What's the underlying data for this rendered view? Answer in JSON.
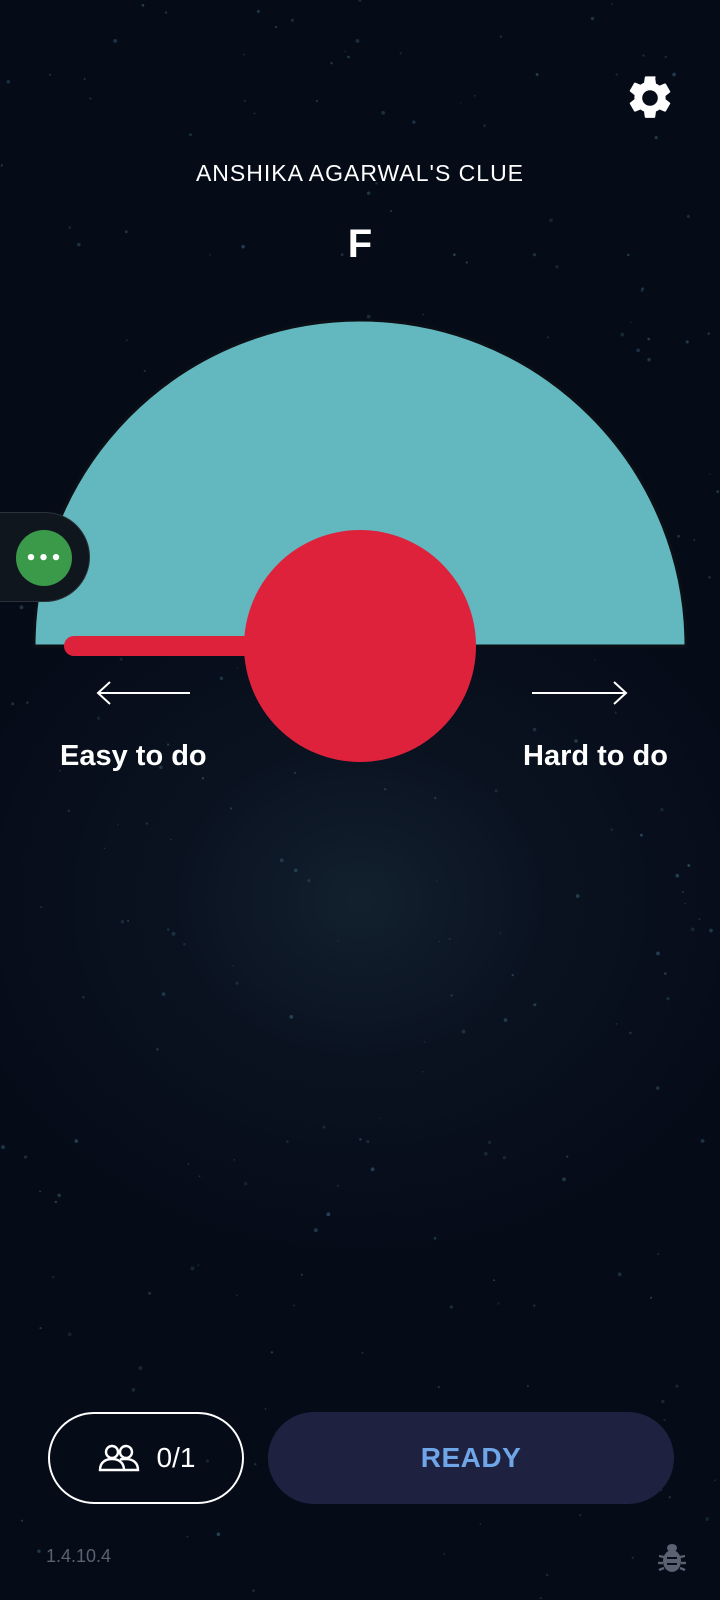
{
  "header": {
    "clue_title": "ANSHIKA AGARWAL'S CLUE",
    "clue": "F",
    "settings_icon": "gear-icon"
  },
  "dial": {
    "left_label": "Easy to do",
    "right_label": "Hard to do",
    "dial_color": "#63b7be",
    "needle_color": "#de223c",
    "needle_position": 0
  },
  "chat": {
    "icon": "chat-bubble-icon",
    "label": "•••"
  },
  "footer": {
    "players_icon": "users-icon",
    "players_count": "0/1",
    "ready_label": "READY",
    "version": "1.4.10.4",
    "debug_icon": "bug-icon"
  }
}
